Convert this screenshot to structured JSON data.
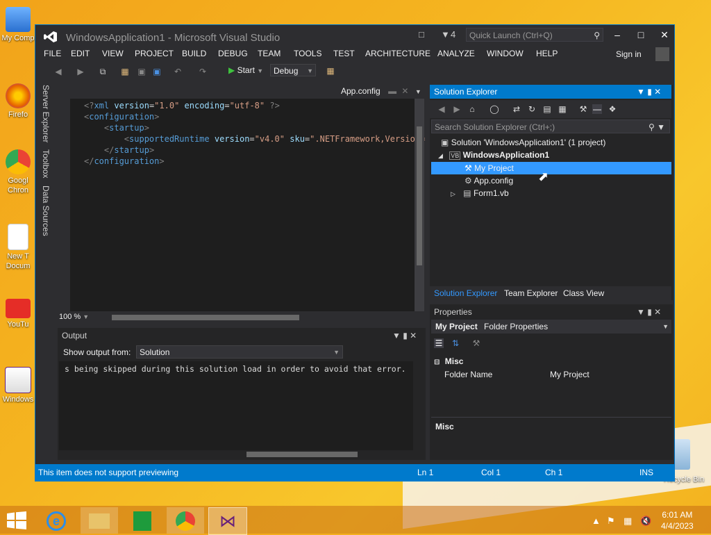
{
  "desktop": {
    "icons": [
      {
        "label": "My Comp",
        "icon": "computer-icon",
        "color": "#4a90e2"
      },
      {
        "label": "Firefo",
        "icon": "firefox-icon",
        "color": "#e66000"
      },
      {
        "label": "Googl",
        "label2": "Chron",
        "icon": "chrome-icon",
        "color": "#34a853"
      },
      {
        "label": "New T",
        "label2": "Docum",
        "icon": "document-icon",
        "color": "#ffffff"
      },
      {
        "label": "YouTu",
        "icon": "youtube-icon",
        "color": "#e52d27"
      },
      {
        "label": "Windows",
        "icon": "vs-installer-icon",
        "color": "#68217a"
      }
    ],
    "recycle_bin": "Recycle Bin"
  },
  "window": {
    "title": "WindowsApplication1 - Microsoft Visual Studio",
    "notifications": "4",
    "quick_launch_placeholder": "Quick Launch (Ctrl+Q)",
    "sign_in": "Sign in"
  },
  "menu": [
    "FILE",
    "EDIT",
    "VIEW",
    "PROJECT",
    "BUILD",
    "DEBUG",
    "TEAM",
    "TOOLS",
    "TEST",
    "ARCHITECTURE",
    "ANALYZE",
    "WINDOW",
    "HELP"
  ],
  "toolbar": {
    "start": "Start",
    "config": "Debug"
  },
  "side_tabs": [
    "Server Explorer",
    "Toolbox",
    "Data Sources"
  ],
  "editor": {
    "tab": "App.config",
    "zoom": "100 %",
    "lines": [
      {
        "indent": "",
        "open": "<?",
        "tag": "xml",
        "attrs": [
          {
            "n": "version",
            "v": "\"1.0\""
          },
          {
            "n": "encoding",
            "v": "\"utf-8\""
          }
        ],
        "close": " ?>"
      },
      {
        "indent": "",
        "open": "<",
        "tag": "configuration",
        "attrs": [],
        "close": ">"
      },
      {
        "indent": "    ",
        "open": "<",
        "tag": "startup",
        "attrs": [],
        "close": ">"
      },
      {
        "indent": "        ",
        "open": "<",
        "tag": "supportedRuntime",
        "attrs": [
          {
            "n": "version",
            "v": "\"v4.0\""
          },
          {
            "n": "sku",
            "v": "\".NETFramework,Version="
          }
        ],
        "close": ""
      },
      {
        "indent": "    ",
        "open": "</",
        "tag": "startup",
        "attrs": [],
        "close": ">"
      },
      {
        "indent": "",
        "open": "</",
        "tag": "configuration",
        "attrs": [],
        "close": ">"
      }
    ]
  },
  "output": {
    "title": "Output",
    "show_from_label": "Show output from:",
    "source": "Solution",
    "text": "s being skipped during this solution load in order to avoid that error."
  },
  "solution_explorer": {
    "title": "Solution Explorer",
    "search_placeholder": "Search Solution Explorer (Ctrl+;)",
    "solution": "Solution 'WindowsApplication1' (1 project)",
    "project": "WindowsApplication1",
    "items": [
      "My Project",
      "App.config",
      "Form1.vb"
    ],
    "tabs": [
      "Solution Explorer",
      "Team Explorer",
      "Class View"
    ]
  },
  "properties": {
    "title": "Properties",
    "object": "My Project",
    "object_type": "Folder Properties",
    "category": "Misc",
    "rows": [
      {
        "name": "Folder Name",
        "value": "My Project"
      }
    ],
    "desc_title": "Misc"
  },
  "status": {
    "message": "This item does not support previewing",
    "ln": "Ln 1",
    "col": "Col 1",
    "ch": "Ch 1",
    "mode": "INS"
  },
  "clock": {
    "time": "6:01 AM",
    "date": "4/4/2023"
  },
  "colors": {
    "accent": "#007acc",
    "selection": "#3399ff",
    "bg": "#2d2d30"
  }
}
